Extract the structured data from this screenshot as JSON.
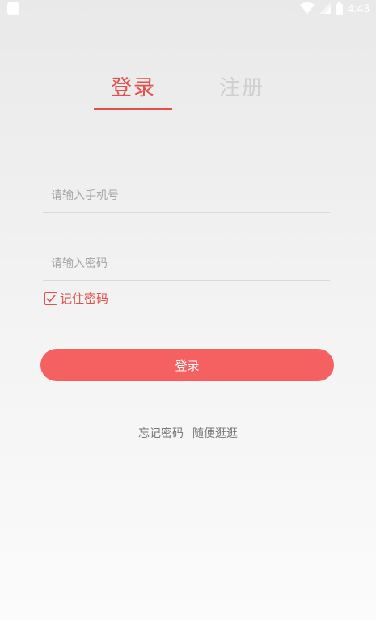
{
  "status_bar": {
    "time": "4:43",
    "icons": [
      "app-notification-icon",
      "wifi-icon",
      "signal-icon",
      "battery-icon"
    ]
  },
  "tabs": {
    "login": "登录",
    "register": "注册",
    "active": "login",
    "active_color": "#e0504c",
    "inactive_color": "#cfcfcf"
  },
  "form": {
    "phone_placeholder": "请输入手机号",
    "phone_value": "",
    "password_placeholder": "请输入密码",
    "password_value": "",
    "remember_label": "记住密码",
    "remember_checked": true,
    "submit_label": "登录",
    "button_color": "#f56161"
  },
  "links": {
    "forgot_password": "忘记密码",
    "browse": "随便逛逛"
  }
}
